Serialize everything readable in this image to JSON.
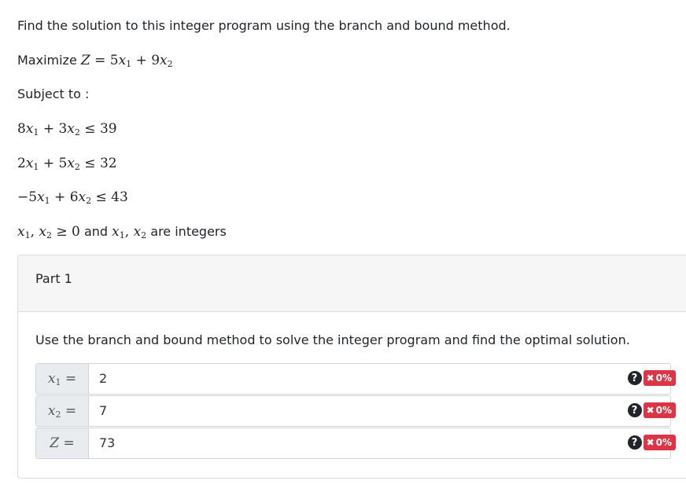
{
  "question": {
    "intro": "Find the solution to this integer program using the branch and bound method.",
    "objective_prefix": "Maximize",
    "subject_to": "Subject to :",
    "nonneg_and": "and",
    "nonneg_suffix": "are integers"
  },
  "part": {
    "title": "Part 1",
    "instruction": "Use the branch and bound method to solve the integer program and find the optimal solution."
  },
  "answers": [
    {
      "label": "x1 =",
      "value": "2",
      "score": "0%"
    },
    {
      "label": "x2 =",
      "value": "7",
      "score": "0%"
    },
    {
      "label": "Z =",
      "value": "73",
      "score": "0%"
    }
  ],
  "icons": {
    "help": "question-circle-icon",
    "incorrect": "x-mark-icon"
  },
  "colors": {
    "incorrect_badge": "#dc3545",
    "help_icon": "#212529"
  }
}
